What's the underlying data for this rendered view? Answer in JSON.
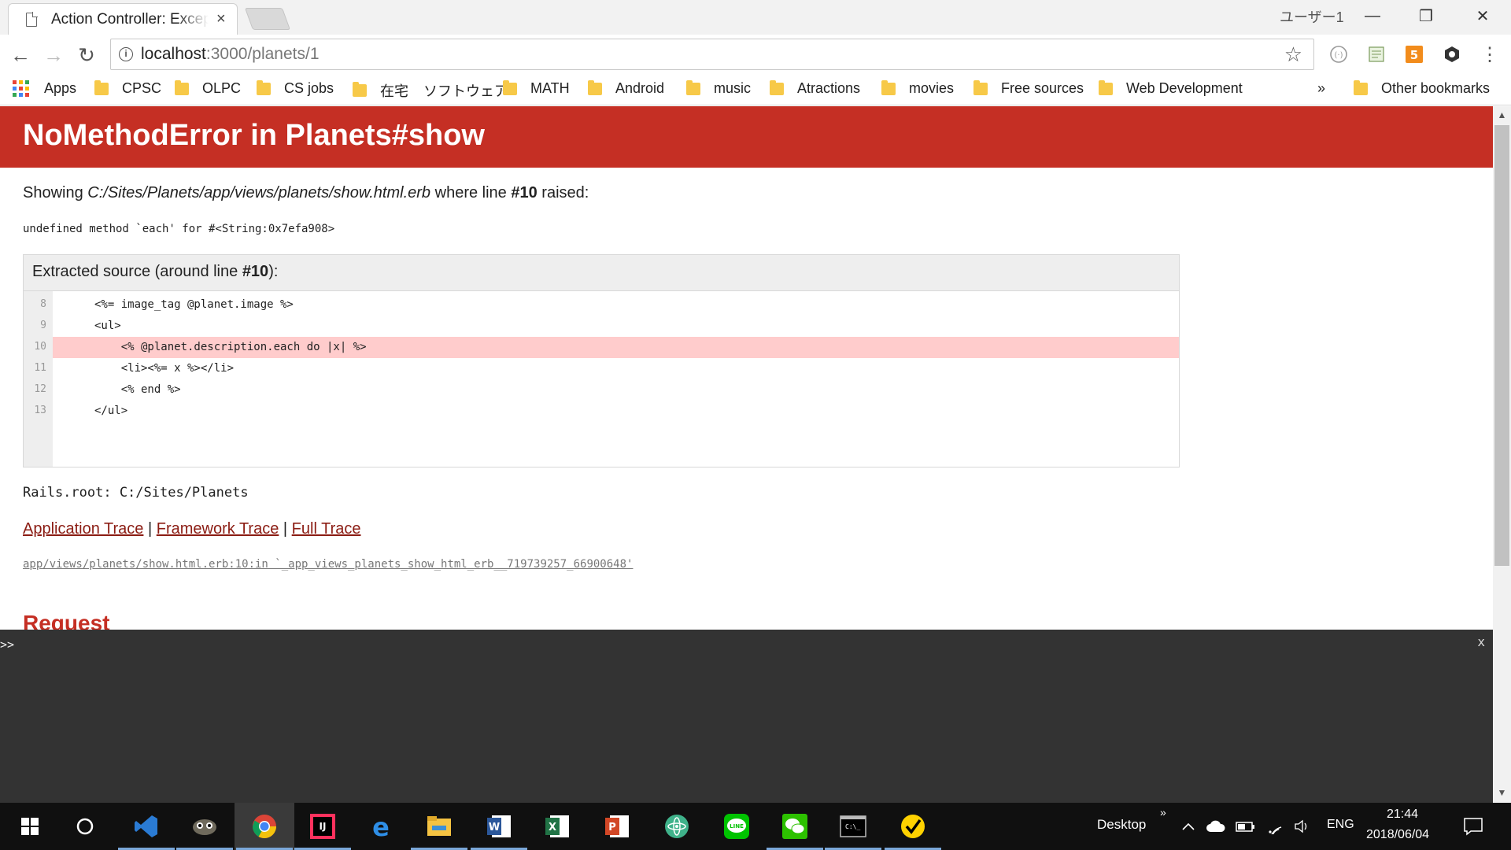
{
  "browser": {
    "tab_title": "Action Controller: Exception caught",
    "tab_close": "×",
    "user_label": "ユーザー1",
    "window_controls": {
      "minimize": "—",
      "restore": "❐",
      "close": "✕"
    },
    "url_host": "localhost",
    "url_path": ":3000/planets/1",
    "nav": {
      "back": "←",
      "forward": "→",
      "reload": "↻"
    },
    "star": "☆",
    "menu": "⋮"
  },
  "bookmarks": {
    "apps_label": "Apps",
    "items": [
      "CPSC",
      "OLPC",
      "CS jobs",
      "在宅",
      "ソフトウェア",
      "MATH",
      "Android",
      "music",
      "Atractions",
      "movies",
      "Free sources",
      "Web Development"
    ],
    "overflow": "»",
    "other": "Other bookmarks"
  },
  "error": {
    "title": "NoMethodError in Planets#show",
    "showing_prefix": "Showing",
    "template_path": "C:/Sites/Planets/app/views/planets/show.html.erb",
    "where_text": "where line",
    "line_ref": "#10",
    "raised_text": "raised:",
    "message": "undefined method `each' for #<String:0x7efa908>",
    "source_heading_prefix": "Extracted source (around line",
    "source_heading_line": "#10",
    "source_heading_suffix": "):",
    "highlight_line": 10,
    "source_lines": [
      {
        "num": "8",
        "code": "<%= image_tag @planet.image %>"
      },
      {
        "num": "9",
        "code": "<ul>"
      },
      {
        "num": "10",
        "code": "    <% @planet.description.each do |x| %>"
      },
      {
        "num": "11",
        "code": "    <li><%= x %></li>"
      },
      {
        "num": "12",
        "code": "    <% end %>"
      },
      {
        "num": "13",
        "code": "</ul>"
      }
    ],
    "rails_root": "Rails.root: C:/Sites/Planets",
    "trace_links": [
      "Application Trace",
      "Framework Trace",
      "Full Trace"
    ],
    "trace_separator": "|",
    "trace_line": "app/views/planets/show.html.erb:10:in `_app_views_planets_show_html_erb__719739257_66900648'",
    "next_section": "Request"
  },
  "console": {
    "prompt": ">>",
    "close": "x"
  },
  "taskbar": {
    "desktop_label": "Desktop",
    "overflow": "»",
    "language": "ENG",
    "time": "21:44",
    "date": "2018/06/04"
  },
  "colors": {
    "error_red": "#c52f24",
    "highlight": "#ffcccc",
    "link": "#8b1c13",
    "console_bg": "#333333",
    "taskbar_bg": "#101010"
  }
}
